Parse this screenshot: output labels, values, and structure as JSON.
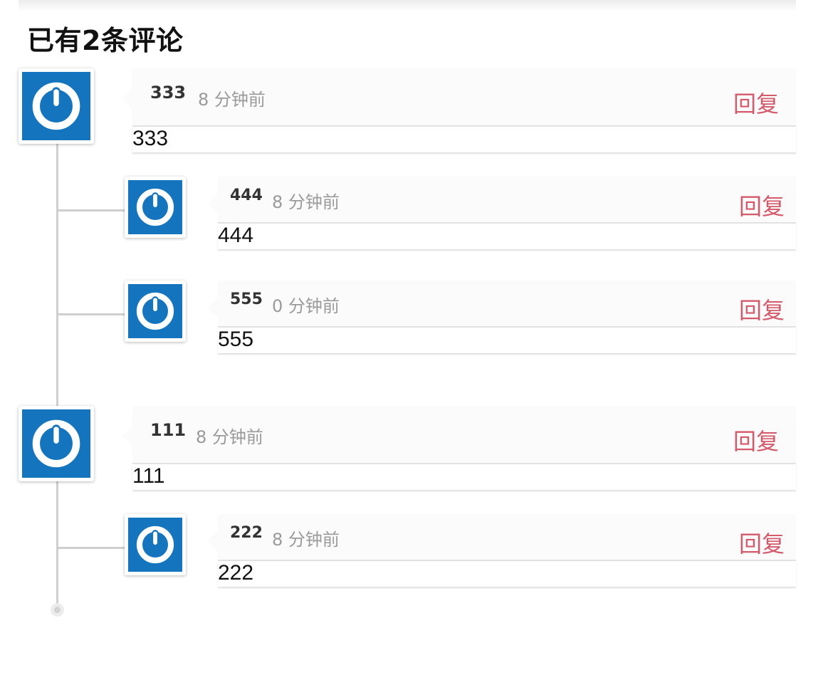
{
  "heading": "已有2条评论",
  "reply_label": "回复",
  "colors": {
    "avatar_bg": "#1474bd",
    "reply": "#d45a6b",
    "timeline": "#cfcfcf"
  },
  "comments": [
    {
      "author": "333",
      "time": "8 分钟前",
      "text": "333",
      "avatar_icon": "power-icon",
      "replies": [
        {
          "author": "444",
          "time": "8 分钟前",
          "text": "444",
          "avatar_icon": "power-icon"
        },
        {
          "author": "555",
          "time": "0 分钟前",
          "text": "555",
          "avatar_icon": "power-icon"
        }
      ]
    },
    {
      "author": "111",
      "time": "8 分钟前",
      "text": "111",
      "avatar_icon": "power-icon",
      "replies": [
        {
          "author": "222",
          "time": "8 分钟前",
          "text": "222",
          "avatar_icon": "power-icon"
        }
      ]
    }
  ]
}
